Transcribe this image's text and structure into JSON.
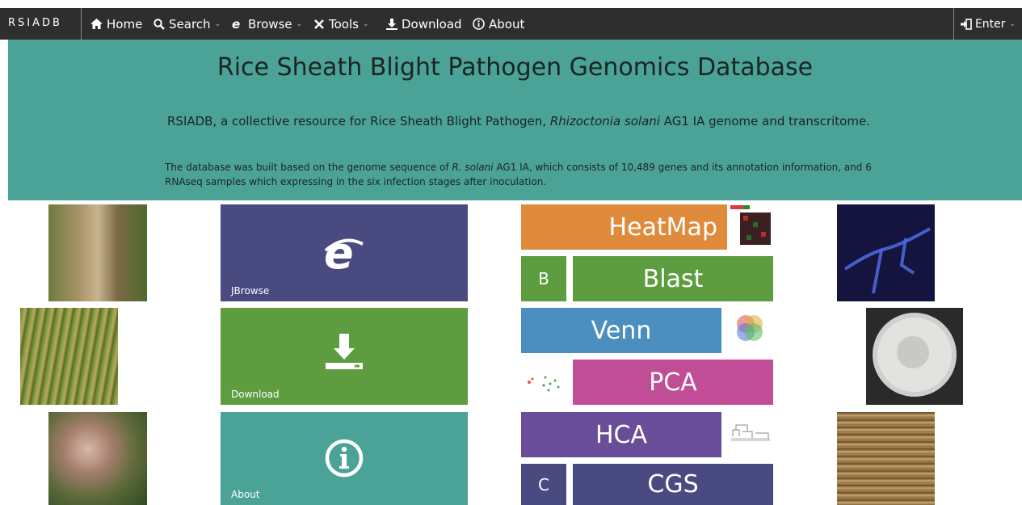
{
  "nav": {
    "brand": "RSIADB",
    "items": [
      {
        "label": "Home",
        "icon": "home-icon",
        "caret": false
      },
      {
        "label": "Search",
        "icon": "search-icon",
        "caret": true
      },
      {
        "label": "Browse",
        "icon": "ie-browser-icon",
        "caret": true
      },
      {
        "label": "Tools",
        "icon": "tools-icon",
        "caret": true
      },
      {
        "label": "Download",
        "icon": "download-icon",
        "caret": false
      },
      {
        "label": "About",
        "icon": "info-icon",
        "caret": false
      }
    ],
    "enter_label": "Enter"
  },
  "hero": {
    "title": "Rice Sheath Blight Pathogen Genomics Database",
    "subtitle_pre": "RSIADB, a collective resource for Rice Sheath Blight Pathogen, ",
    "subtitle_italic": "Rhizoctonia solani",
    "subtitle_post": " AG1 IA genome and transcritome.",
    "desc_pre": "The database was built based on the genome sequence of ",
    "desc_italic": "R. solani",
    "desc_post": " AG1 IA, which consists of 10,489 genes and its annotation information, and 6 RNAseq samples which expressing in the six infection stages after inoculation."
  },
  "tiles": {
    "jbrowse": "JBrowse",
    "download": "Download",
    "about": "About"
  },
  "tools": {
    "heatmap": "HeatMap",
    "b": "B",
    "blast": "Blast",
    "venn": "Venn",
    "pca": "PCA",
    "hca": "HCA",
    "c": "C",
    "cgs": "CGS"
  },
  "colors": {
    "navbar": "#2e2e2e",
    "hero": "#4aa396",
    "tile_blue": "#484a80",
    "tile_green": "#5d9c3f",
    "tile_orange": "#e08a3c",
    "tile_lightblue": "#4a8fbf",
    "tile_magenta": "#c24d97",
    "tile_purple": "#6a4d99"
  }
}
